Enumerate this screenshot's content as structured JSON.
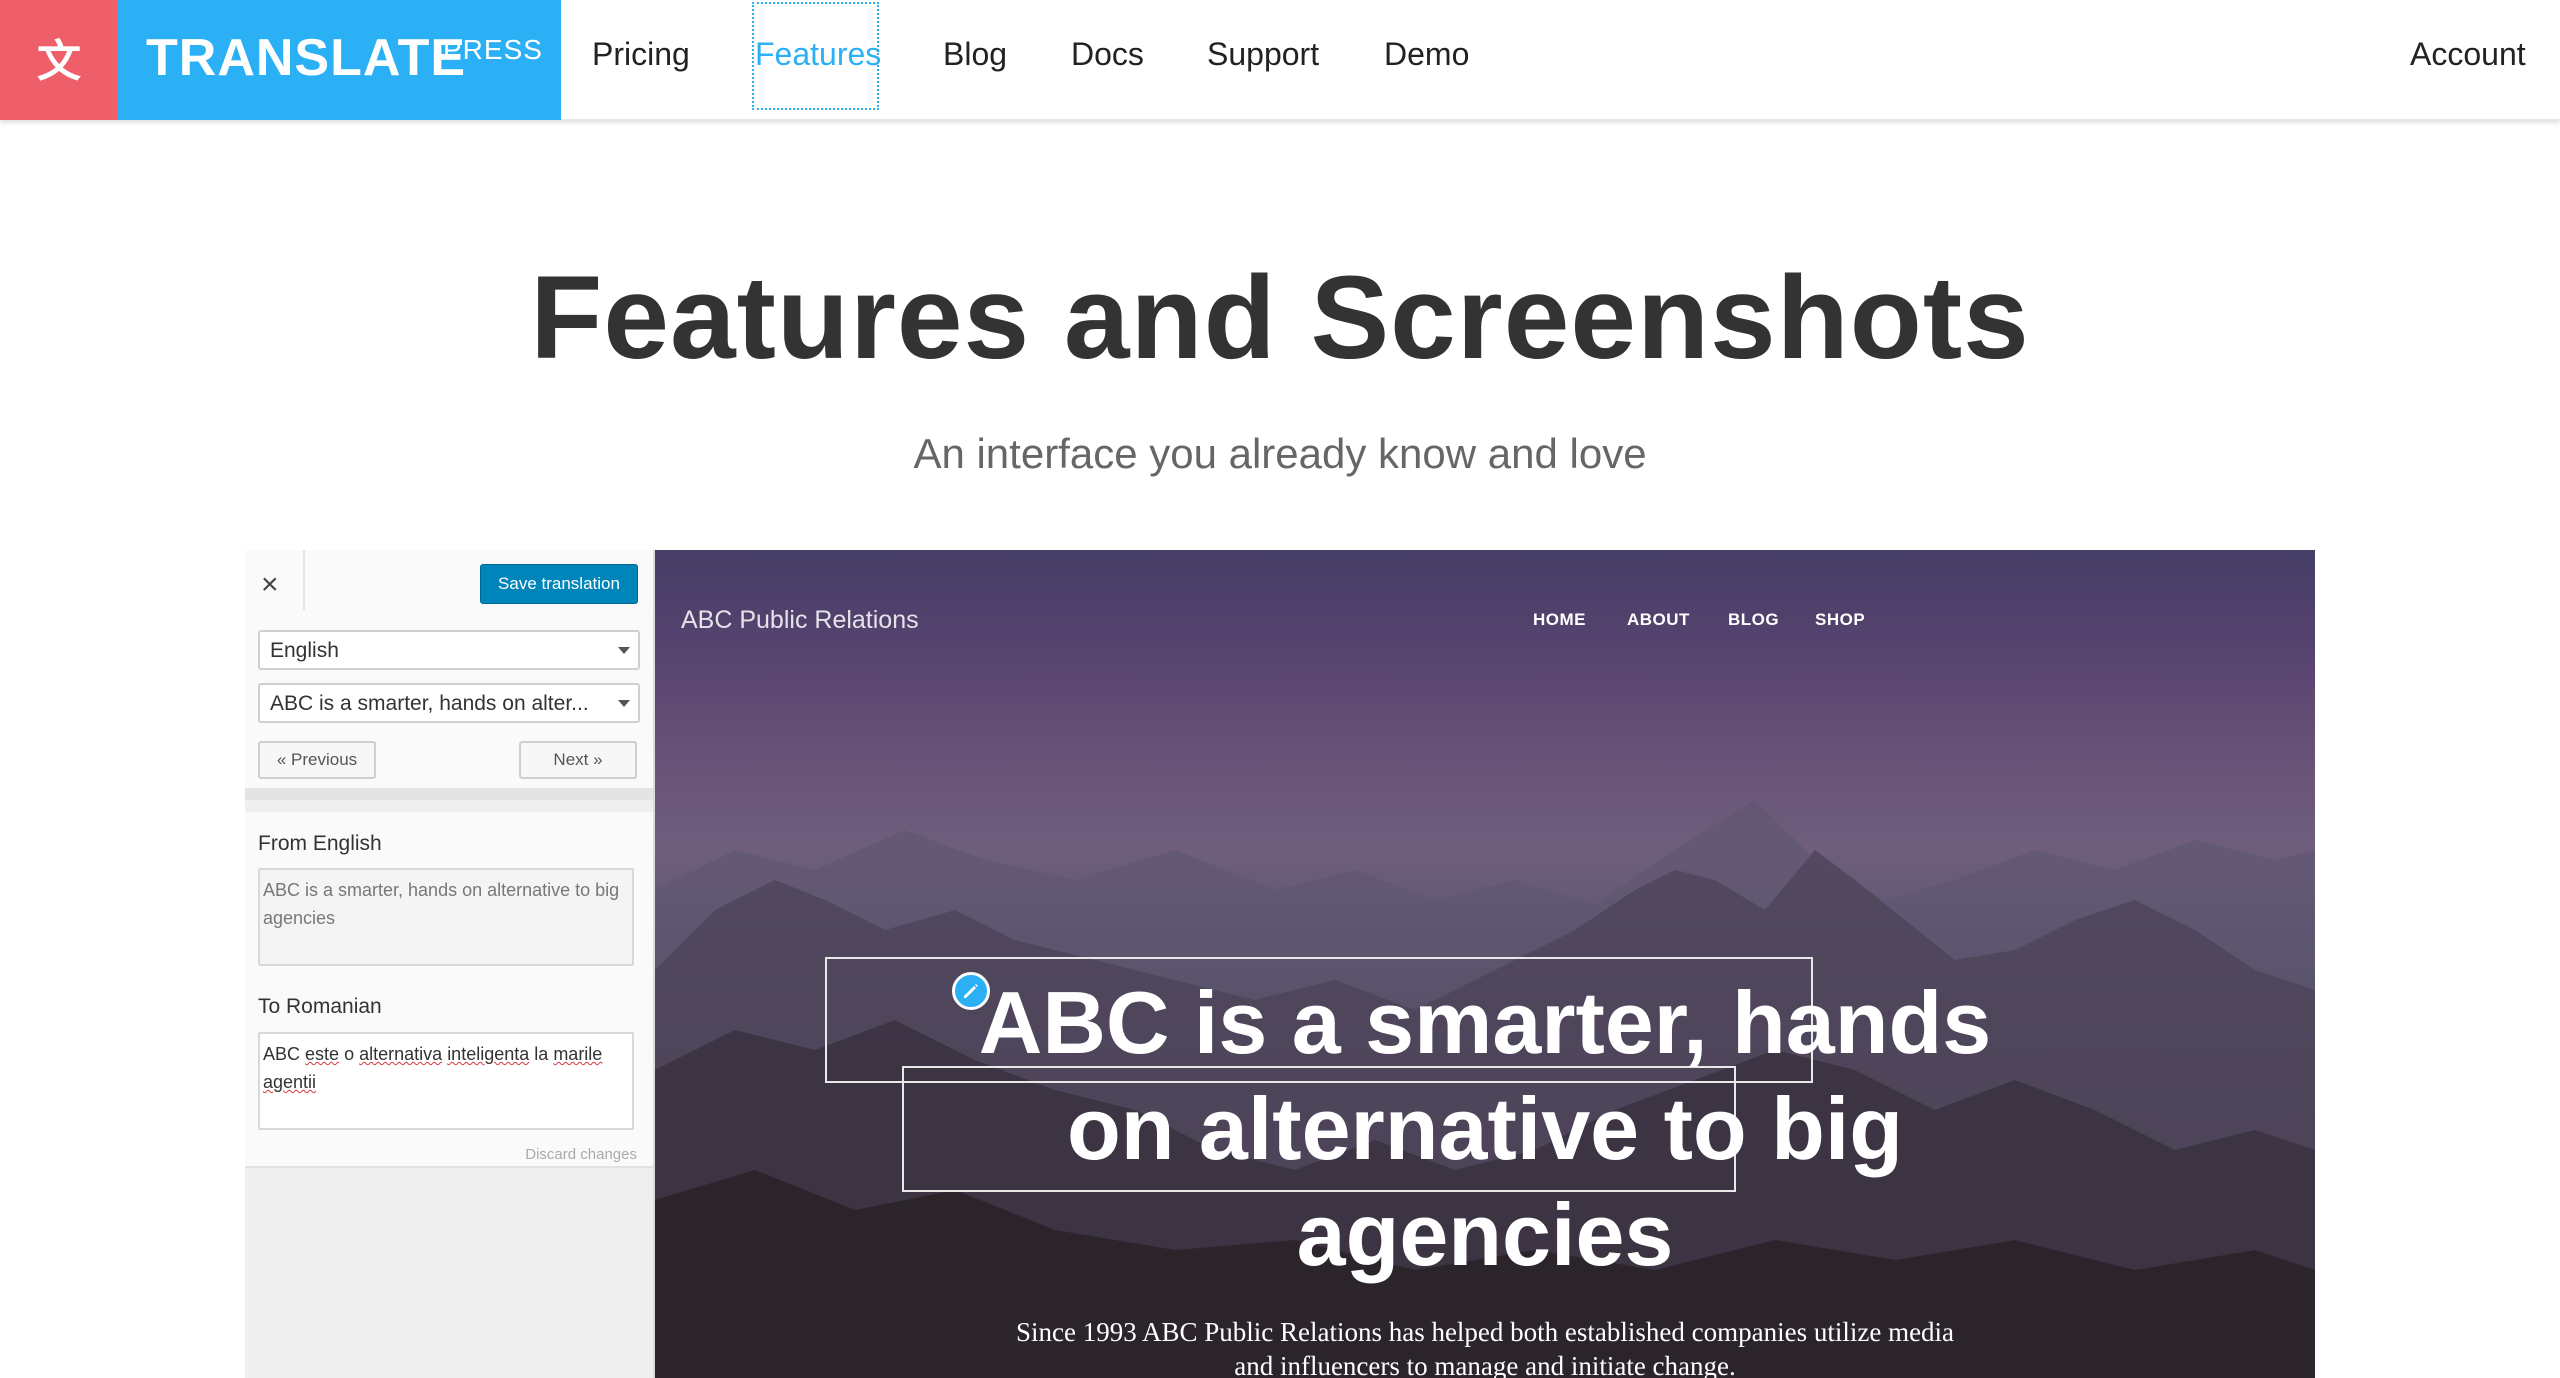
{
  "nav": {
    "logo_glyph": "文",
    "logo_main": "TRANSLATE",
    "logo_sup": "PRESS",
    "links": [
      "Pricing",
      "Features",
      "Blog",
      "Docs",
      "Support",
      "Demo"
    ],
    "active": "Features",
    "account": "Account"
  },
  "hero": {
    "title": "Features and Screenshots",
    "subtitle": "An interface you already know and love"
  },
  "editor": {
    "close_glyph": "×",
    "save_button": "Save translation",
    "language_select": "English",
    "string_select": "ABC is a smarter, hands on alter...",
    "previous_button": "« Previous",
    "next_button": "Next »",
    "from_label": "From English",
    "from_text": "ABC is a smarter, hands on alternative to big agencies",
    "to_label": "To Romanian",
    "to_words": [
      "ABC",
      "este",
      "o",
      "alternativa",
      "inteligenta",
      "la",
      "marile",
      "agentii"
    ],
    "discard": "Discard changes"
  },
  "preview": {
    "brand": "ABC Public Relations",
    "nav": [
      "HOME",
      "ABOUT",
      "BLOG",
      "SHOP"
    ],
    "headline_lines": [
      "ABC is a smarter, hands",
      "on alternative to big",
      "agencies"
    ],
    "paragraph_lines": [
      "Since 1993 ABC Public Relations has helped both established companies utilize media",
      "and influencers to manage and initiate change."
    ],
    "edit_icon": "pencil-icon"
  },
  "colors": {
    "brand_red": "#ee5f6a",
    "brand_blue": "#2bb0f5",
    "wp_button": "#0085ba"
  }
}
